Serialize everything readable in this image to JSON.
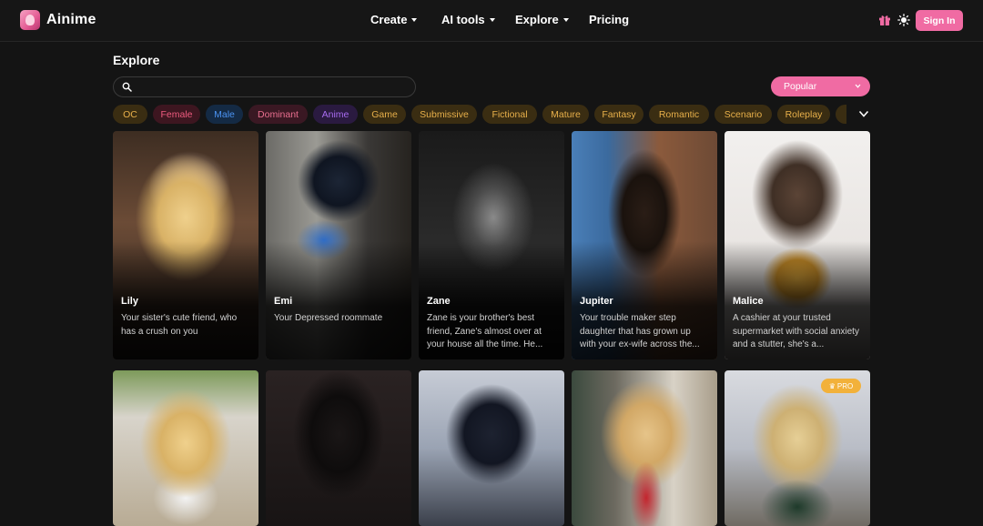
{
  "app": {
    "title": "Ainime"
  },
  "nav": {
    "create": "Create",
    "ai_tools": "AI tools",
    "explore": "Explore",
    "pricing": "Pricing"
  },
  "header_icons": [
    "gift-icon",
    "sun-icon"
  ],
  "signin_label": "Sign In",
  "explore": {
    "title": "Explore",
    "search_placeholder": "",
    "sort_value": "Popular"
  },
  "tags": [
    {
      "label": "OC",
      "color": "#e8b04a",
      "bg": "#3a2d12"
    },
    {
      "label": "Female",
      "color": "#ef5b7f",
      "bg": "#3d1620"
    },
    {
      "label": "Male",
      "color": "#4b93f2",
      "bg": "#142a44"
    },
    {
      "label": "Dominant",
      "color": "#e96f8f",
      "bg": "#3a1823"
    },
    {
      "label": "Anime",
      "color": "#a86cf0",
      "bg": "#2a1a40"
    },
    {
      "label": "Game",
      "color": "#e8b04a",
      "bg": "#3a2d12"
    },
    {
      "label": "Submissive",
      "color": "#e8b04a",
      "bg": "#3a2d12"
    },
    {
      "label": "Fictional",
      "color": "#e8b04a",
      "bg": "#3a2d12"
    },
    {
      "label": "Mature",
      "color": "#e8b04a",
      "bg": "#3a2d12"
    },
    {
      "label": "Fantasy",
      "color": "#e8b04a",
      "bg": "#3a2d12"
    },
    {
      "label": "Romantic",
      "color": "#e8b04a",
      "bg": "#3a2d12"
    },
    {
      "label": "Scenario",
      "color": "#e8b04a",
      "bg": "#3a2d12"
    },
    {
      "label": "Roleplay",
      "color": "#e8b04a",
      "bg": "#3a2d12"
    },
    {
      "label": "T",
      "color": "#e8b04a",
      "bg": "#3a2d12"
    }
  ],
  "cards": [
    {
      "name": "Lily",
      "desc": "Your sister's cute friend, who has a crush on you"
    },
    {
      "name": "Emi",
      "desc": "Your Depressed roommate"
    },
    {
      "name": "Zane",
      "desc": "Zane is your brother's best friend, Zane's almost over at your house all the time. He..."
    },
    {
      "name": "Jupiter",
      "desc": "Your trouble maker step daughter that has grown up with your ex-wife across the..."
    },
    {
      "name": "Malice",
      "desc": "A cashier at your trusted supermarket with social anxiety and a stutter, she's a..."
    }
  ],
  "row2_badge": "PRO"
}
